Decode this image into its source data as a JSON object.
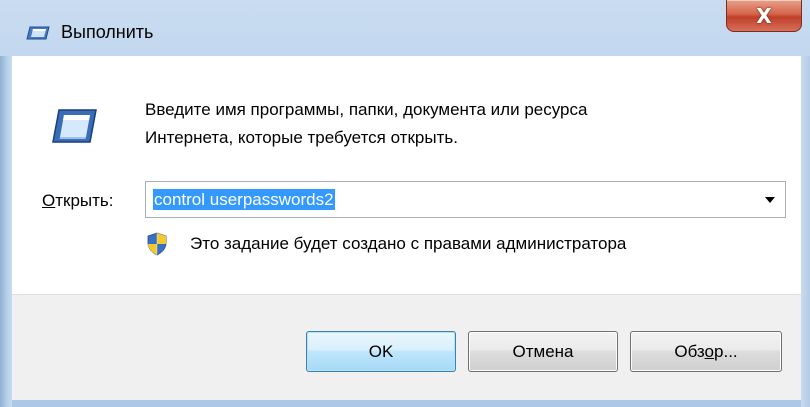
{
  "window": {
    "title": "Выполнить",
    "close_glyph": "X",
    "icon": "run-dialog-icon"
  },
  "dialog": {
    "description_line1": "Введите имя программы, папки, документа или ресурса",
    "description_line2": "Интернета, которые требуется открыть.",
    "open_label_access": "О",
    "open_label_rest": "ткрыть:",
    "open_value": "control userpasswords2",
    "admin_note": "Это задание будет создано с правами администратора",
    "admin_icon": "uac-shield-icon"
  },
  "buttons": {
    "ok": "OK",
    "cancel": "Отмена",
    "browse_pre": "Обз",
    "browse_access": "о",
    "browse_post": "р..."
  },
  "colors": {
    "frame": "#b6cfea",
    "selection": "#3399ff",
    "close_button": "#c1402a",
    "ok_border": "#3c7fb1"
  }
}
